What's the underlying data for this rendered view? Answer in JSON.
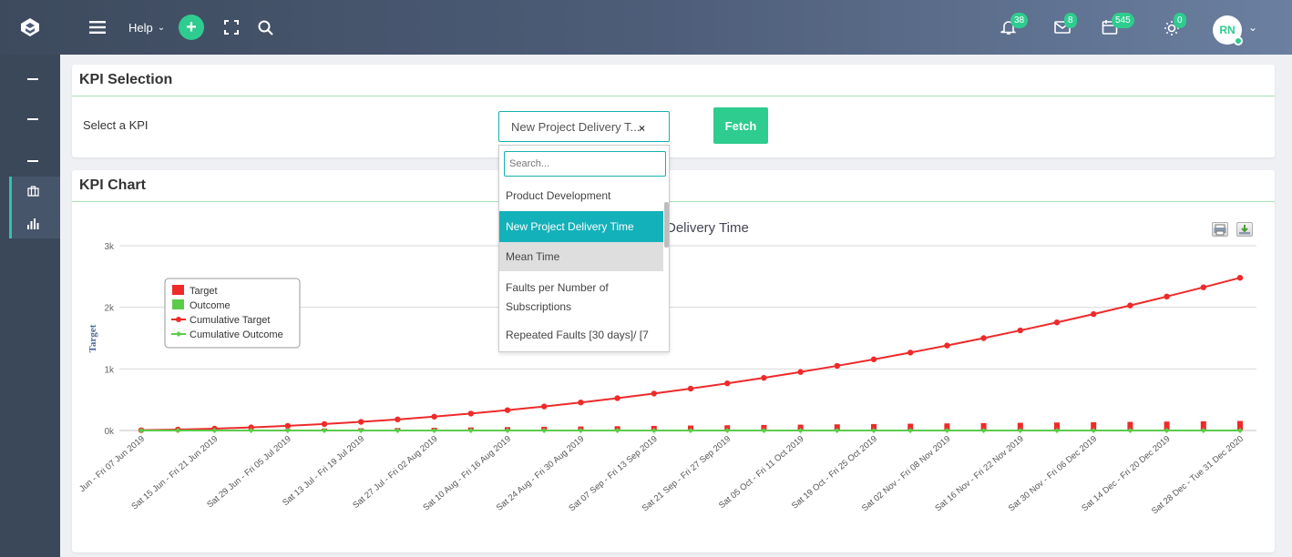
{
  "topbar": {
    "help_label": "Help",
    "plus_label": "+",
    "notifications": [
      {
        "icon": "bell-icon",
        "count": "38"
      },
      {
        "icon": "mail-icon",
        "count": "8"
      },
      {
        "icon": "calendar-icon",
        "count": "545"
      },
      {
        "icon": "sun-icon",
        "count": "0"
      }
    ],
    "user_initials": "RN"
  },
  "kpi_selection": {
    "title": "KPI Selection",
    "select_label": "Select a KPI",
    "selected_value": "New Project Delivery T...",
    "clear_symbol": "×",
    "fetch_label": "Fetch"
  },
  "dropdown": {
    "search_placeholder": "Search...",
    "options": [
      {
        "label": "Product Development",
        "state": "normal"
      },
      {
        "label": "New Project Delivery Time",
        "state": "selected"
      },
      {
        "label": "Mean Time",
        "state": "hover"
      },
      {
        "label": "Faults per Number of Subscriptions",
        "state": "normal"
      },
      {
        "label": "Repeated Faults [30 days]/ [7",
        "state": "normal"
      }
    ]
  },
  "kpi_chart": {
    "title": "KPI Chart",
    "chart_title_visible": "Delivery Time"
  },
  "chart_data": {
    "type": "bar",
    "title": "Delivery Time",
    "ylabel": "Target",
    "ylim": [
      0,
      3000
    ],
    "yticks": [
      "0k",
      "1k",
      "2k",
      "3k"
    ],
    "x_tick_labels": [
      "Jun - Fri 07 Jun 2019",
      "Sat 15 Jun - Fri 21 Jun 2019",
      "Sat 29 Jun - Fri 05 Jul 2019",
      "Sat 13 Jul - Fri 19 Jul 2019",
      "Sat 27 Jul - Fri 02 Aug 2019",
      "Sat 10 Aug - Fri 16 Aug 2019",
      "Sat 24 Aug - Fri 30 Aug 2019",
      "Sat 07 Sep - Fri 13 Sep 2019",
      "Sat 21 Sep - Fri 27 Sep 2019",
      "Sat 05 Oct - Fri 11 Oct 2019",
      "Sat 19 Oct - Fri 25 Oct 2019",
      "Sat 02 Nov - Fri 08 Nov 2019",
      "Sat 16 Nov - Fri 22 Nov 2019",
      "Sat 30 Nov - Fri 06 Dec 2019",
      "Sat 14 Dec - Fri 20 Dec 2019",
      "Sat 28 Dec - Tue 31 Dec 2020"
    ],
    "legend": [
      {
        "name": "Target",
        "color": "#ee2a2a",
        "kind": "bar"
      },
      {
        "name": "Outcome",
        "color": "#5ccb4a",
        "kind": "bar"
      },
      {
        "name": "Cumulative Target",
        "color": "#ee2a2a",
        "kind": "line"
      },
      {
        "name": "Cumulative Outcome",
        "color": "#5ccb4a",
        "kind": "line"
      }
    ],
    "series": [
      {
        "name": "Target",
        "values": [
          5,
          10,
          15,
          20,
          25,
          30,
          35,
          40,
          45,
          50,
          55,
          60,
          65,
          70,
          75,
          80,
          85,
          90,
          95,
          100,
          105,
          110,
          115,
          120,
          125,
          130,
          135,
          140,
          145,
          150,
          155
        ]
      },
      {
        "name": "Outcome",
        "values": [
          0,
          0,
          0,
          0,
          0,
          0,
          0,
          0,
          0,
          0,
          0,
          0,
          0,
          0,
          0,
          0,
          0,
          0,
          0,
          0,
          0,
          0,
          0,
          0,
          0,
          0,
          0,
          0,
          0,
          0,
          0
        ]
      },
      {
        "name": "Cumulative Target",
        "values": [
          5,
          15,
          30,
          50,
          75,
          105,
          140,
          180,
          225,
          275,
          330,
          390,
          455,
          525,
          600,
          680,
          765,
          855,
          950,
          1050,
          1155,
          1265,
          1380,
          1500,
          1625,
          1755,
          1890,
          2030,
          2175,
          2325,
          2480
        ]
      },
      {
        "name": "Cumulative Outcome",
        "values": [
          0,
          0,
          0,
          0,
          0,
          0,
          0,
          0,
          0,
          0,
          0,
          0,
          0,
          0,
          0,
          0,
          0,
          0,
          0,
          0,
          0,
          0,
          0,
          0,
          0,
          0,
          0,
          0,
          0,
          0,
          0
        ]
      }
    ],
    "grid": true,
    "legend_position": "top-left",
    "colors": {
      "target": "#ee2a2a",
      "outcome": "#5ccb4a",
      "axis_text": "#666",
      "grid": "#d8d8d8"
    }
  }
}
